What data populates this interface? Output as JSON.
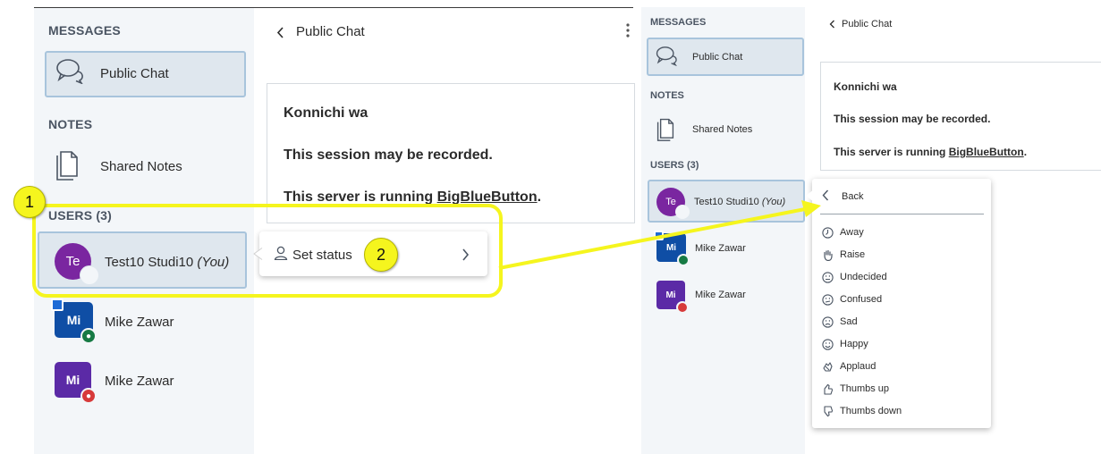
{
  "left_panel": {
    "messages_title": "MESSAGES",
    "public_chat_label": "Public Chat",
    "notes_title": "NOTES",
    "shared_notes_label": "Shared Notes",
    "users_title": "USERS (3)",
    "users": [
      {
        "initials": "Te",
        "name": "Test10 Studi10",
        "you": "(You)",
        "color": "#7a26a0"
      },
      {
        "initials": "Mi",
        "name": "Mike Zawar",
        "color": "#0f4ea5"
      },
      {
        "initials": "Mi",
        "name": "Mike Zawar",
        "color": "#5b2aa6"
      }
    ],
    "chat_back_label": "Public Chat",
    "welcome": {
      "line1": "Konnichi wa",
      "line2": "This session may be recorded.",
      "line3_prefix": "This server is running ",
      "line3_link": "BigBlueButton",
      "line3_suffix": "."
    },
    "status_menu": {
      "label": "Set status"
    }
  },
  "callouts": {
    "one": "1",
    "two": "2"
  },
  "right_panel": {
    "messages_title": "MESSAGES",
    "public_chat_label": "Public Chat",
    "notes_title": "NOTES",
    "shared_notes_label": "Shared Notes",
    "users_title": "USERS (3)",
    "users": [
      {
        "initials": "Te",
        "name": "Test10 Studi10",
        "you": "(You)"
      },
      {
        "initials": "Mi",
        "name": "Mike Zawar"
      },
      {
        "initials": "Mi",
        "name": "Mike Zawar"
      }
    ],
    "chat_back_label": "Public Chat",
    "welcome": {
      "line1": "Konnichi wa",
      "line2": "This session may be recorded.",
      "line3_prefix": "This server is running ",
      "line3_link": "BigBlueButton",
      "line3_suffix": "."
    },
    "status_options_menu": {
      "back_label": "Back",
      "options": [
        {
          "label": "Away",
          "icon": "clock-icon"
        },
        {
          "label": "Raise",
          "icon": "raised-hand-icon"
        },
        {
          "label": "Undecided",
          "icon": "undecided-face-icon"
        },
        {
          "label": "Confused",
          "icon": "confused-face-icon"
        },
        {
          "label": "Sad",
          "icon": "sad-face-icon"
        },
        {
          "label": "Happy",
          "icon": "happy-face-icon"
        },
        {
          "label": "Applaud",
          "icon": "applaud-icon"
        },
        {
          "label": "Thumbs up",
          "icon": "thumbs-up-icon"
        },
        {
          "label": "Thumbs down",
          "icon": "thumbs-down-icon"
        }
      ]
    }
  },
  "colors": {
    "highlight": "#f5f51e",
    "sidebar_bg": "#f3f6f9",
    "selected_bg": "#dfe7ee",
    "selected_border": "#a8c4dc",
    "presenter_badge": "#167a44",
    "muted_badge": "#d73a3a"
  }
}
